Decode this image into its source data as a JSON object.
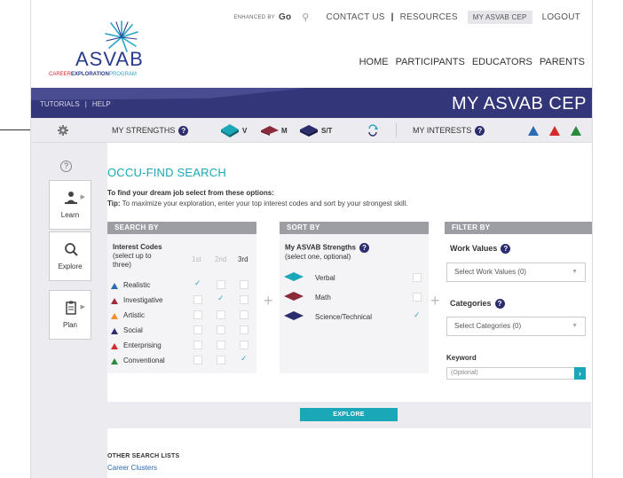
{
  "top_nav": {
    "enhanced_by": "ENHANCED BY",
    "go": "Go",
    "contact_us": "CONTACT US",
    "separator": "|",
    "resources": "RESOURCES",
    "my_asvab_cep": "MY ASVAB CEP",
    "logout": "LOGOUT"
  },
  "logo": {
    "name": "ASVAB",
    "sub_career": "CAREER",
    "sub_exploration": "EXPLORATION",
    "sub_program": "PROGRAM"
  },
  "main_nav": [
    "HOME",
    "PARTICIPANTS",
    "EDUCATORS",
    "PARENTS"
  ],
  "banner": {
    "tutorials": "TUTORIALS",
    "sep": "|",
    "help": "HELP",
    "title": "MY ASVAB CEP"
  },
  "strengths_bar": {
    "my_strengths": "MY STRENGTHS",
    "v": "V",
    "m": "M",
    "st": "S/T",
    "my_interests": "MY INTERESTS",
    "qmark": "?"
  },
  "sidebar": {
    "help": "?",
    "items": [
      {
        "label": "Learn"
      },
      {
        "label": "Explore"
      },
      {
        "label": "Plan"
      }
    ]
  },
  "content": {
    "title": "OCCU-FIND SEARCH",
    "instruction": "To find your dream job select from these options:",
    "tip_label": "Tip:",
    "tip_text": "To maximize your exploration, enter your top interest codes and sort by your strongest skill."
  },
  "search_by": {
    "header": "SEARCH BY",
    "interest_codes_title": "Interest Codes",
    "interest_codes_sub1": "(select up to",
    "interest_codes_sub2": "three)",
    "col_1st": "1st",
    "col_2nd": "2nd",
    "col_3rd": "3rd",
    "rows": [
      {
        "name": "Realistic",
        "color": "#2a6ab3",
        "checked": 1
      },
      {
        "name": "Investigative",
        "color": "#a32a35",
        "checked": 2
      },
      {
        "name": "Artistic",
        "color": "#f0902a",
        "checked": 0
      },
      {
        "name": "Social",
        "color": "#2b2d6e",
        "checked": 0
      },
      {
        "name": "Enterprising",
        "color": "#d42a2a",
        "checked": 0
      },
      {
        "name": "Conventional",
        "color": "#2a8a3a",
        "checked": 3
      }
    ]
  },
  "sort_by": {
    "header": "SORT BY",
    "title": "My ASVAB Strengths",
    "sub": "(select one, optional)",
    "rows": [
      {
        "name": "Verbal",
        "color": "#1aa7b8",
        "checked": false
      },
      {
        "name": "Math",
        "color": "#8a2a3a",
        "checked": false
      },
      {
        "name": "Science/Technical",
        "color": "#2b2d6e",
        "checked": true
      }
    ]
  },
  "filter_by": {
    "header": "FILTER BY",
    "work_values_label": "Work Values",
    "work_values_select": "Select Work Values (0)",
    "categories_label": "Categories",
    "categories_select": "Select Categories (0)",
    "keyword_label": "Keyword",
    "keyword_placeholder": "(Optional)",
    "go": "›"
  },
  "explore_button": "EXPLORE",
  "other_lists": {
    "title": "OTHER SEARCH LISTS",
    "link": "Career Clusters"
  },
  "colors": {
    "brand_navy": "#34367a",
    "accent_teal": "#1aa7b8",
    "panel_gray": "#9c9ea3"
  }
}
